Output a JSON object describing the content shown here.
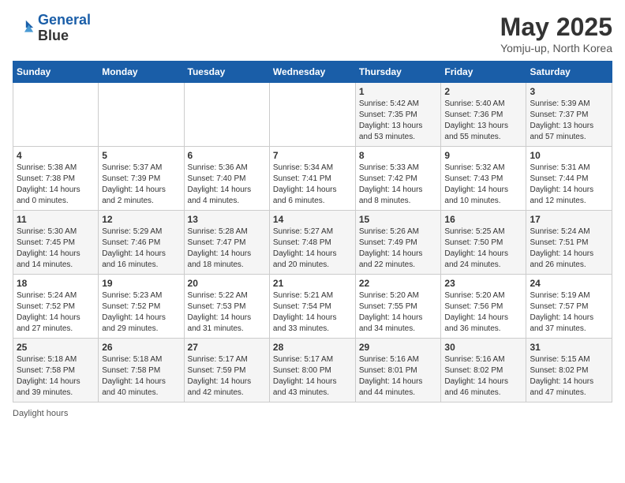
{
  "header": {
    "logo_line1": "General",
    "logo_line2": "Blue",
    "month": "May 2025",
    "location": "Yomju-up, North Korea"
  },
  "days_of_week": [
    "Sunday",
    "Monday",
    "Tuesday",
    "Wednesday",
    "Thursday",
    "Friday",
    "Saturday"
  ],
  "footer_text": "Daylight hours",
  "weeks": [
    [
      {
        "day": "",
        "info": ""
      },
      {
        "day": "",
        "info": ""
      },
      {
        "day": "",
        "info": ""
      },
      {
        "day": "",
        "info": ""
      },
      {
        "day": "1",
        "info": "Sunrise: 5:42 AM\nSunset: 7:35 PM\nDaylight: 13 hours\nand 53 minutes."
      },
      {
        "day": "2",
        "info": "Sunrise: 5:40 AM\nSunset: 7:36 PM\nDaylight: 13 hours\nand 55 minutes."
      },
      {
        "day": "3",
        "info": "Sunrise: 5:39 AM\nSunset: 7:37 PM\nDaylight: 13 hours\nand 57 minutes."
      }
    ],
    [
      {
        "day": "4",
        "info": "Sunrise: 5:38 AM\nSunset: 7:38 PM\nDaylight: 14 hours\nand 0 minutes."
      },
      {
        "day": "5",
        "info": "Sunrise: 5:37 AM\nSunset: 7:39 PM\nDaylight: 14 hours\nand 2 minutes."
      },
      {
        "day": "6",
        "info": "Sunrise: 5:36 AM\nSunset: 7:40 PM\nDaylight: 14 hours\nand 4 minutes."
      },
      {
        "day": "7",
        "info": "Sunrise: 5:34 AM\nSunset: 7:41 PM\nDaylight: 14 hours\nand 6 minutes."
      },
      {
        "day": "8",
        "info": "Sunrise: 5:33 AM\nSunset: 7:42 PM\nDaylight: 14 hours\nand 8 minutes."
      },
      {
        "day": "9",
        "info": "Sunrise: 5:32 AM\nSunset: 7:43 PM\nDaylight: 14 hours\nand 10 minutes."
      },
      {
        "day": "10",
        "info": "Sunrise: 5:31 AM\nSunset: 7:44 PM\nDaylight: 14 hours\nand 12 minutes."
      }
    ],
    [
      {
        "day": "11",
        "info": "Sunrise: 5:30 AM\nSunset: 7:45 PM\nDaylight: 14 hours\nand 14 minutes."
      },
      {
        "day": "12",
        "info": "Sunrise: 5:29 AM\nSunset: 7:46 PM\nDaylight: 14 hours\nand 16 minutes."
      },
      {
        "day": "13",
        "info": "Sunrise: 5:28 AM\nSunset: 7:47 PM\nDaylight: 14 hours\nand 18 minutes."
      },
      {
        "day": "14",
        "info": "Sunrise: 5:27 AM\nSunset: 7:48 PM\nDaylight: 14 hours\nand 20 minutes."
      },
      {
        "day": "15",
        "info": "Sunrise: 5:26 AM\nSunset: 7:49 PM\nDaylight: 14 hours\nand 22 minutes."
      },
      {
        "day": "16",
        "info": "Sunrise: 5:25 AM\nSunset: 7:50 PM\nDaylight: 14 hours\nand 24 minutes."
      },
      {
        "day": "17",
        "info": "Sunrise: 5:24 AM\nSunset: 7:51 PM\nDaylight: 14 hours\nand 26 minutes."
      }
    ],
    [
      {
        "day": "18",
        "info": "Sunrise: 5:24 AM\nSunset: 7:52 PM\nDaylight: 14 hours\nand 27 minutes."
      },
      {
        "day": "19",
        "info": "Sunrise: 5:23 AM\nSunset: 7:52 PM\nDaylight: 14 hours\nand 29 minutes."
      },
      {
        "day": "20",
        "info": "Sunrise: 5:22 AM\nSunset: 7:53 PM\nDaylight: 14 hours\nand 31 minutes."
      },
      {
        "day": "21",
        "info": "Sunrise: 5:21 AM\nSunset: 7:54 PM\nDaylight: 14 hours\nand 33 minutes."
      },
      {
        "day": "22",
        "info": "Sunrise: 5:20 AM\nSunset: 7:55 PM\nDaylight: 14 hours\nand 34 minutes."
      },
      {
        "day": "23",
        "info": "Sunrise: 5:20 AM\nSunset: 7:56 PM\nDaylight: 14 hours\nand 36 minutes."
      },
      {
        "day": "24",
        "info": "Sunrise: 5:19 AM\nSunset: 7:57 PM\nDaylight: 14 hours\nand 37 minutes."
      }
    ],
    [
      {
        "day": "25",
        "info": "Sunrise: 5:18 AM\nSunset: 7:58 PM\nDaylight: 14 hours\nand 39 minutes."
      },
      {
        "day": "26",
        "info": "Sunrise: 5:18 AM\nSunset: 7:58 PM\nDaylight: 14 hours\nand 40 minutes."
      },
      {
        "day": "27",
        "info": "Sunrise: 5:17 AM\nSunset: 7:59 PM\nDaylight: 14 hours\nand 42 minutes."
      },
      {
        "day": "28",
        "info": "Sunrise: 5:17 AM\nSunset: 8:00 PM\nDaylight: 14 hours\nand 43 minutes."
      },
      {
        "day": "29",
        "info": "Sunrise: 5:16 AM\nSunset: 8:01 PM\nDaylight: 14 hours\nand 44 minutes."
      },
      {
        "day": "30",
        "info": "Sunrise: 5:16 AM\nSunset: 8:02 PM\nDaylight: 14 hours\nand 46 minutes."
      },
      {
        "day": "31",
        "info": "Sunrise: 5:15 AM\nSunset: 8:02 PM\nDaylight: 14 hours\nand 47 minutes."
      }
    ]
  ]
}
